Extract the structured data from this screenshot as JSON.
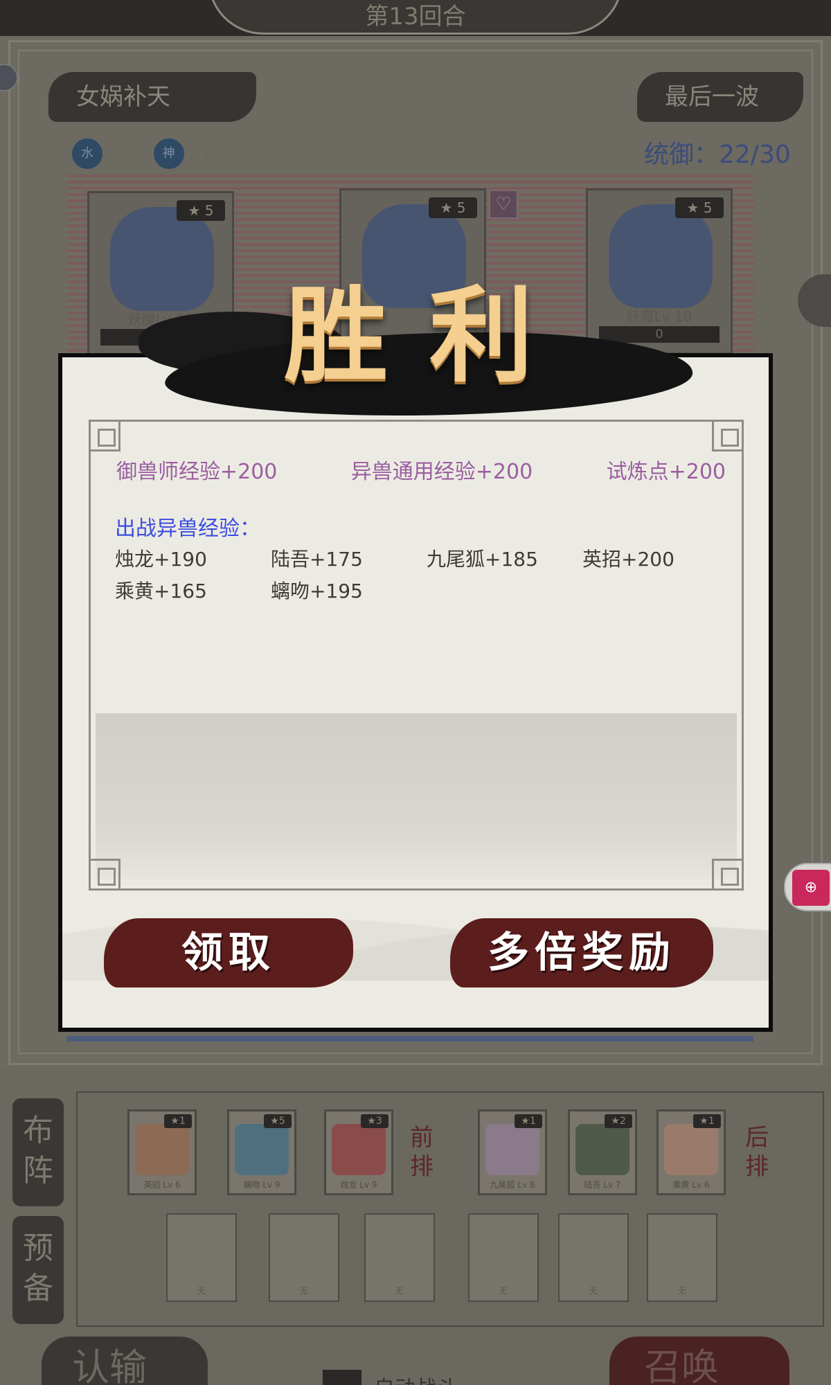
{
  "top": {
    "round": "第13回合"
  },
  "stage": {
    "name": "女娲补天",
    "wave": "最后一波"
  },
  "elements": [
    {
      "icon": "水",
      "count": "x3"
    },
    {
      "icon": "神",
      "count": "x6"
    }
  ],
  "command": "统御：22/30",
  "enemies": [
    {
      "stars": "5",
      "name": "妖魔Lv 10",
      "hp": "0"
    },
    {
      "stars": "5",
      "name": "",
      "hp": ""
    },
    {
      "stars": "5",
      "name": "妖魔Lv 10",
      "hp": "0"
    }
  ],
  "dialog": {
    "title": "胜利",
    "rewards": [
      "御兽师经验+200",
      "异兽通用经验+200",
      "试炼点+200"
    ],
    "exp_title": "出战异兽经验：",
    "exp_items": [
      "烛龙+190",
      "陆吾+175",
      "九尾狐+185",
      "英招+200",
      "乘黄+165",
      "螭吻+195"
    ],
    "claim_label": "领取",
    "multi_label": "多倍奖励"
  },
  "sidebar": {
    "formation": "布阵",
    "reserve": "预备"
  },
  "lineup": {
    "front_label": "前排",
    "back_label": "后排",
    "units": [
      {
        "stars": "1",
        "name": "英招 Lv 6"
      },
      {
        "stars": "5",
        "name": "螭吻 Lv 9"
      },
      {
        "stars": "3",
        "name": "烛龙 Lv 9"
      },
      {
        "stars": "1",
        "name": "九尾狐 Lv 8"
      },
      {
        "stars": "2",
        "name": "陆吾 Lv 7"
      },
      {
        "stars": "1",
        "name": "乘黄 Lv 6"
      }
    ],
    "empty_label": "无"
  },
  "bottom": {
    "surrender": "认输",
    "auto": "自动战斗",
    "summon": "召唤"
  },
  "colors": {
    "accent_red": "#5c1d1d",
    "reward_purple": "#9a5ea0",
    "exp_blue": "#3c4de0",
    "victory_gold": "#f4cf8f"
  }
}
